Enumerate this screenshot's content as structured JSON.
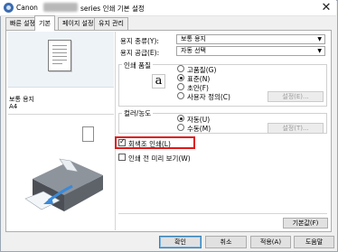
{
  "window": {
    "title_prefix": "Canon",
    "title_suffix": "series 인쇄 기본 설정",
    "close": "✕"
  },
  "tabs": [
    {
      "label": "빠른 설정"
    },
    {
      "label": "기본"
    },
    {
      "label": "페이지 설정"
    },
    {
      "label": "유지 관리"
    }
  ],
  "preview": {
    "media_label": "보통 용지",
    "size_label": "A4"
  },
  "settings": {
    "media_type": {
      "label": "용지 종류(Y):",
      "value": "보통 용지"
    },
    "paper_source": {
      "label": "용지 공급(E):",
      "value": "자동 선택"
    },
    "print_quality": {
      "title": "인쇄 품질",
      "icon_glyph": "a",
      "options": [
        {
          "label": "고품질(G)",
          "selected": false
        },
        {
          "label": "표준(N)",
          "selected": true
        },
        {
          "label": "초안(F)",
          "selected": false
        },
        {
          "label": "사용자 정의(C)",
          "selected": false
        }
      ],
      "set_button": "설정(E)..."
    },
    "color_intensity": {
      "title": "컬러/농도",
      "options": [
        {
          "label": "자동(U)",
          "selected": true
        },
        {
          "label": "수동(M)",
          "selected": false
        }
      ],
      "set_button": "설정(T)..."
    },
    "grayscale": {
      "label": "회색조 인쇄(L)",
      "checked": true
    },
    "preview_before_print": {
      "label": "인쇄 전 미리 보기(W)",
      "checked": false
    },
    "defaults_button": "기본값(F)"
  },
  "footer": {
    "ok": "확인",
    "cancel": "취소",
    "apply": "적용(A)",
    "help": "도움말"
  },
  "colors": {
    "highlight": "#e01818",
    "accent": "#3c7fb1"
  }
}
